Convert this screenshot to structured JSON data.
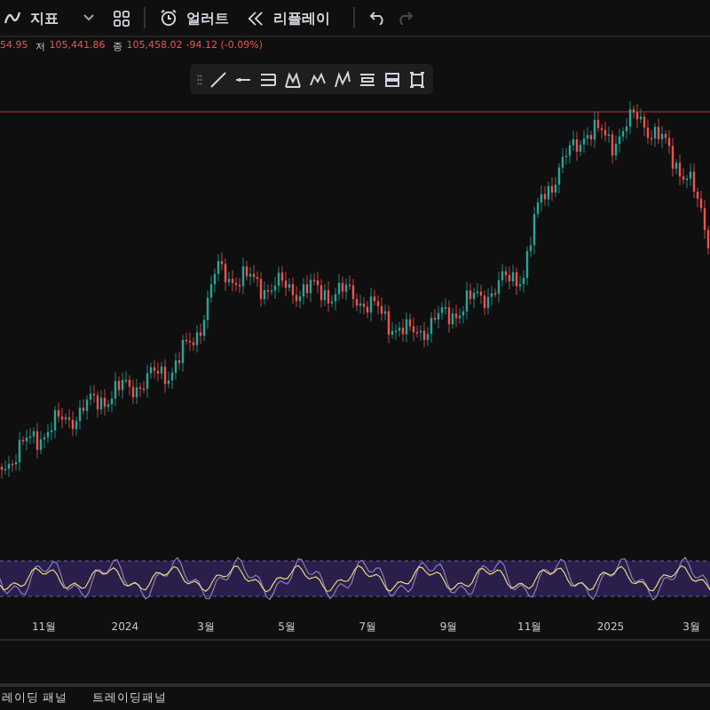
{
  "toolbar": {
    "indicators_label": "지표",
    "alert_label": "얼러트",
    "replay_label": "리플레이",
    "undo": {
      "disabled": false
    },
    "redo": {
      "disabled": true
    }
  },
  "legend": [
    {
      "value": "54.95"
    },
    {
      "label": "저",
      "value": "105,441.86"
    },
    {
      "label": "종",
      "value": "105,458.02"
    },
    {
      "value": "-94.12 (-0.09%)"
    }
  ],
  "time_axis": [
    "11월",
    "2024",
    "3월",
    "5월",
    "7월",
    "9월",
    "11월",
    "2025",
    "3월"
  ],
  "bottom_tabs": [
    {
      "label": "레이딩 패널"
    },
    {
      "label": "트레이딩패널"
    }
  ]
}
